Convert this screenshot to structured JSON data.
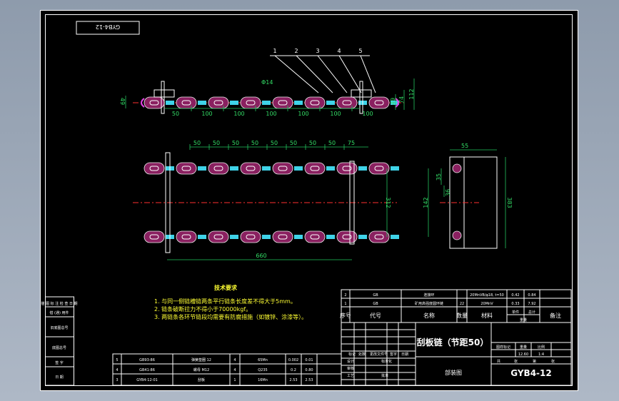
{
  "drawing_no_stamp": "GYB4-12",
  "balloons": [
    "1",
    "2",
    "3",
    "4",
    "5"
  ],
  "dims": {
    "hole_dia": "Φ14",
    "left_height": "49",
    "right_small": "49",
    "right_mid": "74",
    "right_total": "112",
    "pitch_first": "50",
    "pitch": "100",
    "top_pitch": [
      "50",
      "50",
      "50",
      "50",
      "50",
      "50",
      "50",
      "50",
      "75"
    ],
    "plan_width": "312",
    "plan_length": "660",
    "side_top": "55",
    "side_a": "35",
    "side_b": "36",
    "side_c": "142",
    "side_total": "383"
  },
  "tech_req": {
    "title": "技术要求",
    "items": [
      "1. 与同一侧链槽链两条平行链条长度差不得大于5mm。",
      "2. 链条破断拉力不得小于70000kgf。",
      "3. 两链条各环节链段均需要有防腐措施（如镀锌、涂漆等）。"
    ]
  },
  "left_block": [
    "借 (通) 用件",
    "旧底图总号",
    "底图总号",
    "签 字",
    "日 期"
  ],
  "left_stamp": "描 图 标 注 检 查 日 期",
  "bom_upper": [
    {
      "no": "2",
      "code": "GB",
      "name": "连接环",
      "qty": "",
      "mat": "20MnVB/φ18, t=50",
      "w1": "0.42",
      "w2": "0.84"
    },
    {
      "no": "1",
      "code": "GB",
      "name": "矿用高强度圆环链",
      "qty": "22",
      "mat": "20MnV",
      "w1": "0.33",
      "w2": "7.92"
    }
  ],
  "bom_header": [
    "序号",
    "代号",
    "名称",
    "数量",
    "材料",
    "单件",
    "总计",
    "重量",
    "备注"
  ],
  "bom_lower": [
    {
      "no": "5",
      "code": "GB93-86",
      "name": "弹簧垫圈 12",
      "qty": "4",
      "mat": "65Mn",
      "w1": "0.002",
      "w2": "0.01"
    },
    {
      "no": "4",
      "code": "GB41-86",
      "name": "螺母 M12",
      "qty": "4",
      "mat": "Q235",
      "w1": "0.2",
      "w2": "0.80"
    },
    {
      "no": "3",
      "code": "GYB4-12-01",
      "name": "刮板",
      "qty": "1",
      "mat": "16Mn",
      "w1": "2.53",
      "w2": "2.53"
    }
  ],
  "title_block": {
    "part_name": "刮板链（节距50）",
    "assembly": "部装图",
    "drawing_no": "GYB4-12",
    "mass": "12.60",
    "scale": "1:4",
    "sheet_labels": [
      "共",
      "张",
      "第",
      "张"
    ],
    "stage_labels": [
      "图样标记",
      "重量",
      "比例"
    ],
    "row_labels": [
      "标记",
      "处数",
      "更改文件号",
      "签字",
      "日期"
    ],
    "sign_labels": [
      "设计",
      "审核",
      "工艺",
      "标准化",
      "批准"
    ]
  }
}
